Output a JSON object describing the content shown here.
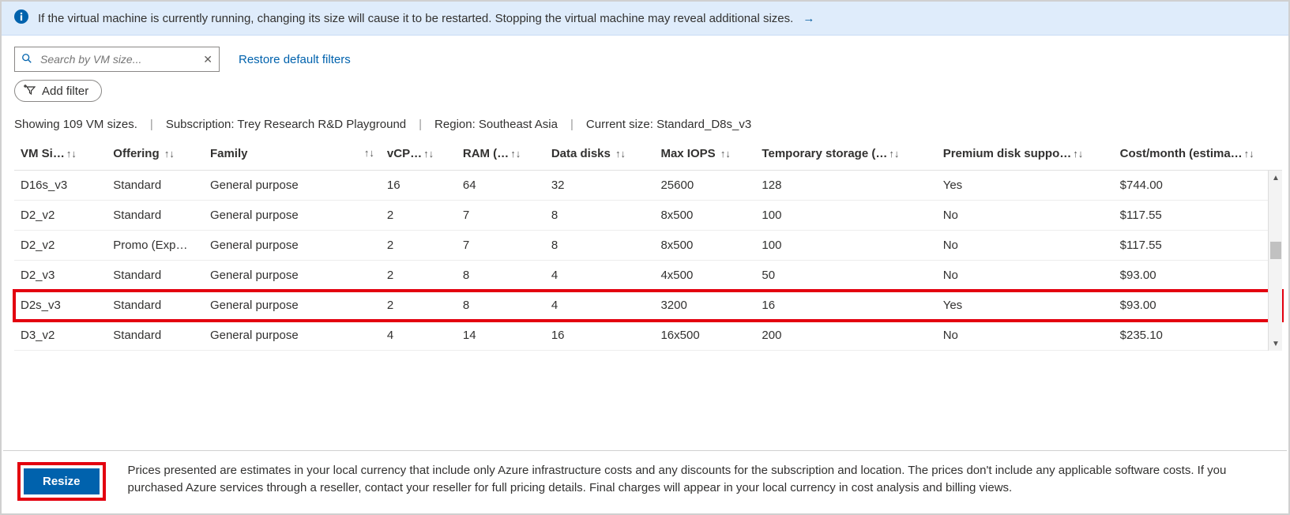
{
  "info": {
    "text": "If the virtual machine is currently running, changing its size will cause it to be restarted. Stopping the virtual machine may reveal additional sizes.",
    "link_arrow": "→"
  },
  "search": {
    "placeholder": "Search by VM size..."
  },
  "restore_filters_label": "Restore default filters",
  "add_filter_label": "Add filter",
  "status": {
    "count_text": "Showing 109 VM sizes.",
    "subscription_label": "Subscription: Trey Research R&D Playground",
    "region_label": "Region: Southeast Asia",
    "current_size_label": "Current size: Standard_D8s_v3"
  },
  "columns": {
    "vm_size": "VM Si…",
    "offering": "Offering",
    "family": "Family",
    "vcpus": "vCP…",
    "ram": "RAM (…",
    "data_disks": "Data disks",
    "max_iops": "Max IOPS",
    "temp_storage": "Temporary storage (…",
    "premium": "Premium disk suppo…",
    "cost": "Cost/month (estima…"
  },
  "rows": [
    {
      "vm_size": "D16s_v3",
      "offering": "Standard",
      "family": "General purpose",
      "vcpus": "16",
      "ram": "64",
      "data_disks": "32",
      "max_iops": "25600",
      "temp_storage": "128",
      "premium": "Yes",
      "cost": "$744.00",
      "highlight": false
    },
    {
      "vm_size": "D2_v2",
      "offering": "Standard",
      "family": "General purpose",
      "vcpus": "2",
      "ram": "7",
      "data_disks": "8",
      "max_iops": "8x500",
      "temp_storage": "100",
      "premium": "No",
      "cost": "$117.55",
      "highlight": false
    },
    {
      "vm_size": "D2_v2",
      "offering": "Promo (Exp…",
      "family": "General purpose",
      "vcpus": "2",
      "ram": "7",
      "data_disks": "8",
      "max_iops": "8x500",
      "temp_storage": "100",
      "premium": "No",
      "cost": "$117.55",
      "highlight": false
    },
    {
      "vm_size": "D2_v3",
      "offering": "Standard",
      "family": "General purpose",
      "vcpus": "2",
      "ram": "8",
      "data_disks": "4",
      "max_iops": "4x500",
      "temp_storage": "50",
      "premium": "No",
      "cost": "$93.00",
      "highlight": false
    },
    {
      "vm_size": "D2s_v3",
      "offering": "Standard",
      "family": "General purpose",
      "vcpus": "2",
      "ram": "8",
      "data_disks": "4",
      "max_iops": "3200",
      "temp_storage": "16",
      "premium": "Yes",
      "cost": "$93.00",
      "highlight": true
    },
    {
      "vm_size": "D3_v2",
      "offering": "Standard",
      "family": "General purpose",
      "vcpus": "4",
      "ram": "14",
      "data_disks": "16",
      "max_iops": "16x500",
      "temp_storage": "200",
      "premium": "No",
      "cost": "$235.10",
      "highlight": false
    }
  ],
  "footer": {
    "resize_label": "Resize",
    "disclaimer": "Prices presented are estimates in your local currency that include only Azure infrastructure costs and any discounts for the subscription and location. The prices don't include any applicable software costs. If you purchased Azure services through a reseller, contact your reseller for full pricing details. Final charges will appear in your local currency in cost analysis and billing views."
  }
}
